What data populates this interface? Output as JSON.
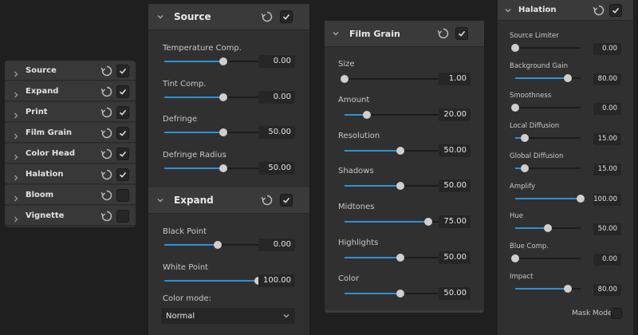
{
  "sidebar": {
    "items": [
      {
        "label": "Source",
        "checked": true
      },
      {
        "label": "Expand",
        "checked": true
      },
      {
        "label": "Print",
        "checked": true
      },
      {
        "label": "Film Grain",
        "checked": true
      },
      {
        "label": "Color Head",
        "checked": true
      },
      {
        "label": "Halation",
        "checked": true
      },
      {
        "label": "Bloom",
        "checked": false
      },
      {
        "label": "Vignette",
        "checked": false
      }
    ]
  },
  "source": {
    "title": "Source",
    "params": [
      {
        "label": "Temperature Comp.",
        "value": "0.00",
        "fraction": 0.5
      },
      {
        "label": "Tint Comp.",
        "value": "0.00",
        "fraction": 0.5
      },
      {
        "label": "Defringe",
        "value": "50.00",
        "fraction": 0.5
      },
      {
        "label": "Defringe Radius",
        "value": "50.00",
        "fraction": 0.5
      }
    ]
  },
  "expand": {
    "title": "Expand",
    "params": [
      {
        "label": "Black Point",
        "value": "0.00",
        "fraction": 0.45
      },
      {
        "label": "White Point",
        "value": "100.00",
        "fraction": 0.8
      }
    ],
    "color_mode_label": "Color mode:",
    "color_mode_value": "Normal"
  },
  "film_grain": {
    "title": "Film Grain",
    "params": [
      {
        "label": "Size",
        "value": "1.00",
        "fraction": 0.0
      },
      {
        "label": "Amount",
        "value": "20.00",
        "fraction": 0.2
      },
      {
        "label": "Resolution",
        "value": "50.00",
        "fraction": 0.5
      },
      {
        "label": "Shadows",
        "value": "50.00",
        "fraction": 0.5
      },
      {
        "label": "Midtones",
        "value": "75.00",
        "fraction": 0.75
      },
      {
        "label": "Highlights",
        "value": "50.00",
        "fraction": 0.5
      },
      {
        "label": "Color",
        "value": "50.00",
        "fraction": 0.5
      }
    ]
  },
  "halation": {
    "title": "Halation",
    "params": [
      {
        "label": "Source Limiter",
        "value": "0.00",
        "fraction": 0.0
      },
      {
        "label": "Background Gain",
        "value": "80.00",
        "fraction": 0.8
      },
      {
        "label": "Smoothness",
        "value": "0.00",
        "fraction": 0.0
      },
      {
        "label": "Local Diffusion",
        "value": "15.00",
        "fraction": 0.15
      },
      {
        "label": "Global Diffusion",
        "value": "15.00",
        "fraction": 0.15
      },
      {
        "label": "Amplify",
        "value": "100.00",
        "fraction": 1.0
      },
      {
        "label": "Hue",
        "value": "50.00",
        "fraction": 0.5
      },
      {
        "label": "Blue Comp.",
        "value": "0.00",
        "fraction": 0.0
      },
      {
        "label": "Impact",
        "value": "80.00",
        "fraction": 0.8
      }
    ],
    "mask_mode_label": "Mask Mode",
    "mask_mode_checked": false
  },
  "colors": {
    "accent": "#2f8fd4",
    "panel": "#303030",
    "header": "#3a3a3a",
    "background": "#1f1f1f"
  }
}
